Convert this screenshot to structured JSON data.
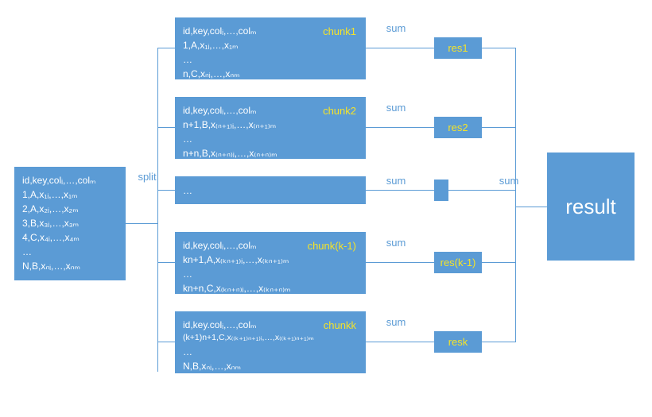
{
  "source": {
    "line1": "id,key,colᵢ,…,colₘ",
    "line2": "1,A,x₁ᵢ,…,x₁ₘ",
    "line3": "2,A,x₂ᵢ,…,x₂ₘ",
    "line4": "3,B,x₃ᵢ,…,x₃ₘ",
    "line5": "4,C,x₄ᵢ,…,x₄ₘ",
    "line6": "…",
    "line7": "N,B,xₙᵢ,…,xₙₘ"
  },
  "ops": {
    "split": "split",
    "sum": "sum"
  },
  "chunks": {
    "c1": {
      "label": "chunk1",
      "line1": "id,key,colᵢ,…,colₘ",
      "line2": "1,A,x₁ᵢ,…,x₁ₘ",
      "line3": "…",
      "line4": "n,C,xₙᵢ,…,xₙₘ",
      "res": "res1"
    },
    "c2": {
      "label": "chunk2",
      "line1": "id,key,colᵢ,…,colₘ",
      "line2": "n+1,B,x₍ₙ₊₁₎ᵢ,…,x₍ₙ₊₁₎ₘ",
      "line3": "…",
      "line4": "n+n,B,x₍ₙ₊ₙ₎ᵢ,…,x₍ₙ₊ₙ₎ₘ",
      "res": "res2"
    },
    "cdots": {
      "text": "…",
      "res": ""
    },
    "ck1": {
      "label": "chunk(k-1)",
      "line1": "id,key,colᵢ,…,colₘ",
      "line2": "kn+1,A,x₍ₖₙ₊₁₎ᵢ,…,x₍ₖₙ₊₁₎ₘ",
      "line3": "…",
      "line4": "kn+n,C,x₍ₖₙ₊ₙ₎ᵢ,…,x₍ₖₙ₊ₙ₎ₘ",
      "res": "res(k-1)"
    },
    "ck": {
      "label": "chunkk",
      "line1": "id,key.colᵢ,…,colₘ",
      "line2": "(k+1)n+1,C,x₍₍ₖ₊₁₎ₙ₊₁₎ᵢ,…,x₍₍ₖ₊₁₎ₙ₊₁₎ₘ",
      "line3": "…",
      "line4": "N,B,xₙᵢ,…,xₙₘ",
      "res": "resk"
    }
  },
  "result": {
    "label": "result"
  },
  "colors": {
    "box": "#5b9bd5",
    "accent": "#f4e32a",
    "text": "#ffffff"
  }
}
